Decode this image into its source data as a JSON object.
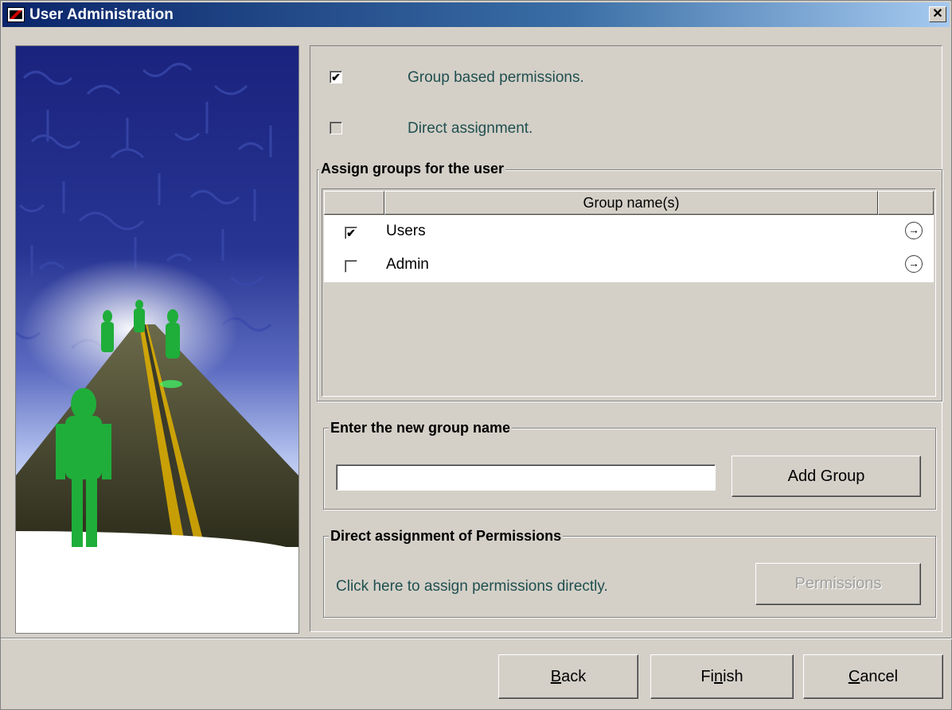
{
  "window": {
    "title": "User Administration",
    "close_symbol": "✕"
  },
  "options": {
    "group_based": {
      "label": "Group based permissions.",
      "checked": true,
      "checkmark": "✔"
    },
    "direct": {
      "label": "Direct assignment.",
      "checked": false,
      "checkmark": ""
    }
  },
  "groups_section": {
    "legend": "Assign groups for the user",
    "columns": [
      "",
      "Group name(s)",
      ""
    ],
    "rows": [
      {
        "name": "Users",
        "checked": true,
        "checkmark": "✔",
        "action_icon": "→"
      },
      {
        "name": "Admin",
        "checked": false,
        "checkmark": "",
        "action_icon": "→"
      }
    ]
  },
  "new_group_section": {
    "legend": "Enter the new group name",
    "input_value": "",
    "add_button": "Add Group"
  },
  "direct_section": {
    "legend": "Direct assignment of Permissions",
    "description": "Click here to assign permissions directly.",
    "permissions_button": "Permissions"
  },
  "footer": {
    "back_pre": "",
    "back_ul": "B",
    "back_post": "ack",
    "finish_pre": "Fi",
    "finish_ul": "n",
    "finish_post": "ish",
    "cancel_pre": "",
    "cancel_ul": "C",
    "cancel_post": "ancel"
  },
  "colors": {
    "title_gradient_start": "#0a246a",
    "dialog_bg": "#d4d0c8",
    "label_teal": "#1f4f4f"
  }
}
